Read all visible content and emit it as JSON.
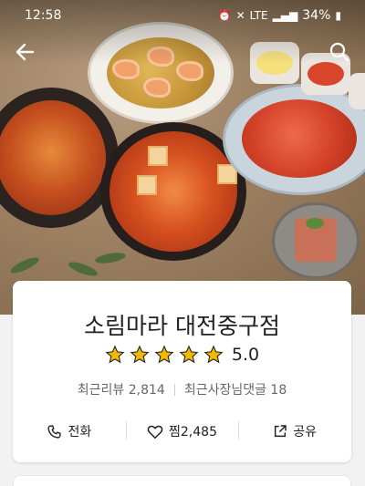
{
  "status_bar": {
    "time": "12:58",
    "battery": "34%",
    "network": "LTE"
  },
  "app_bar": {
    "back_icon": "arrow-left-icon",
    "search_icon": "search-icon"
  },
  "restaurant": {
    "name": "소림마라 대전중구점",
    "rating": "5.0",
    "star_count": 5,
    "recent_reviews": "최근리뷰 2,814",
    "recent_owner_replies": "최근사장님댓글 18"
  },
  "actions": [
    {
      "label": "전화",
      "icon": "phone-icon"
    },
    {
      "label": "찜2,485",
      "icon": "heart-icon"
    },
    {
      "label": "공유",
      "icon": "share-icon"
    }
  ],
  "colors": {
    "star": "#f5b800",
    "text": "#222222",
    "meta_text": "#666666"
  }
}
